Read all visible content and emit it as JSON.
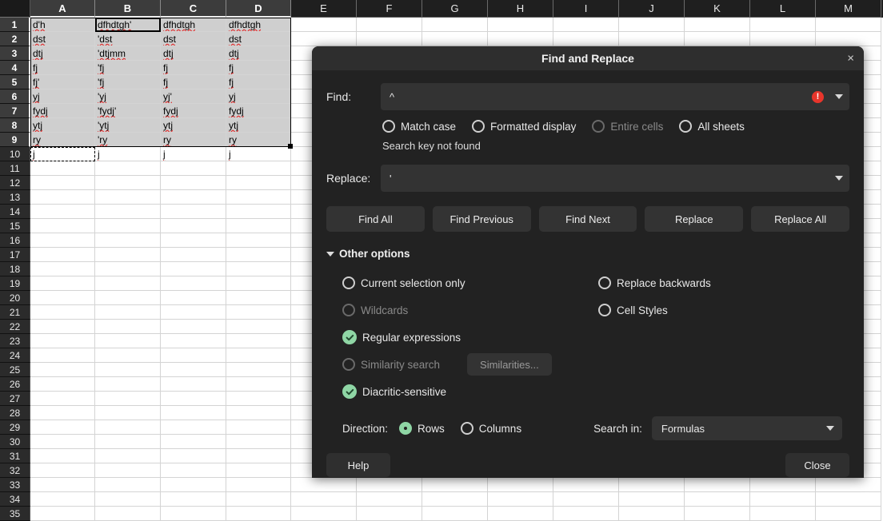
{
  "spreadsheet": {
    "columns": [
      "A",
      "B",
      "C",
      "D",
      "E",
      "F",
      "G",
      "H",
      "I",
      "J",
      "K",
      "L",
      "M"
    ],
    "selected_columns": [
      "A",
      "B",
      "C",
      "D"
    ],
    "row_count": 35,
    "selected_rows": [
      1,
      2,
      3,
      4,
      5,
      6,
      7,
      8,
      9
    ],
    "active_cell": "B1",
    "rows": [
      {
        "n": 1,
        "A": "d'h",
        "B": "dfhdtgh'",
        "C": "dfhdtgh",
        "D": "dfhdtgh"
      },
      {
        "n": 2,
        "A": "dst",
        "B": "'dst",
        "C": "dst",
        "D": "dst"
      },
      {
        "n": 3,
        "A": "dtj",
        "B": "'dtjmm",
        "C": "dtj",
        "D": "dtj"
      },
      {
        "n": 4,
        "A": "fj",
        "B": "'fj",
        "C": "fj",
        "D": "fj"
      },
      {
        "n": 5,
        "A": "fj'",
        "B": "'fj",
        "C": "fj",
        "D": "fj"
      },
      {
        "n": 6,
        "A": "yj",
        "B": "'yj",
        "C": "yj'",
        "D": "yj"
      },
      {
        "n": 7,
        "A": "fydj",
        "B": "'fydj'",
        "C": "fydj",
        "D": "fydj"
      },
      {
        "n": 8,
        "A": "ytj",
        "B": "'ytj",
        "C": "ytj",
        "D": "ytj"
      },
      {
        "n": 9,
        "A": "ry",
        "B": "'ry",
        "C": "ry",
        "D": "ry"
      },
      {
        "n": 10,
        "A": "j",
        "B": "j",
        "C": "j",
        "D": "j"
      }
    ]
  },
  "dialog": {
    "title": "Find and Replace",
    "close_label": "×",
    "find": {
      "label": "Find:",
      "value": "^",
      "error_glyph": "!"
    },
    "find_options": [
      {
        "label": "Match case",
        "state": "off",
        "disabled": false
      },
      {
        "label": "Formatted display",
        "state": "off",
        "disabled": false
      },
      {
        "label": "Entire cells",
        "state": "off",
        "disabled": true
      },
      {
        "label": "All sheets",
        "state": "off",
        "disabled": false
      }
    ],
    "status_message": "Search key not found",
    "replace": {
      "label": "Replace:",
      "value": "'"
    },
    "buttons": [
      {
        "label": "Find All"
      },
      {
        "label": "Find Previous"
      },
      {
        "label": "Find Next"
      },
      {
        "label": "Replace"
      },
      {
        "label": "Replace All"
      }
    ],
    "other_options": {
      "header": "Other options",
      "left": [
        {
          "label": "Current selection only",
          "state": "off",
          "disabled": false
        },
        {
          "label": "Wildcards",
          "state": "off",
          "disabled": true
        },
        {
          "label": "Regular expressions",
          "state": "checked",
          "disabled": false
        },
        {
          "label": "Similarity search",
          "state": "off",
          "disabled": true
        },
        {
          "label": "Diacritic-sensitive",
          "state": "checked",
          "disabled": false
        }
      ],
      "right": [
        {
          "label": "Replace backwards",
          "state": "off",
          "disabled": false
        },
        {
          "label": "Cell Styles",
          "state": "off",
          "disabled": false
        }
      ],
      "similarities_button": "Similarities..."
    },
    "direction": {
      "label": "Direction:",
      "options": [
        {
          "label": "Rows",
          "state": "on"
        },
        {
          "label": "Columns",
          "state": "off"
        }
      ]
    },
    "search_in": {
      "label": "Search in:",
      "value": "Formulas"
    },
    "footer": {
      "help_label": "Help",
      "close_label": "Close"
    }
  },
  "colors": {
    "accent_green": "#8fd6a5",
    "error_red": "#e8352b",
    "dialog_bg": "#222222",
    "field_bg": "#333333"
  }
}
